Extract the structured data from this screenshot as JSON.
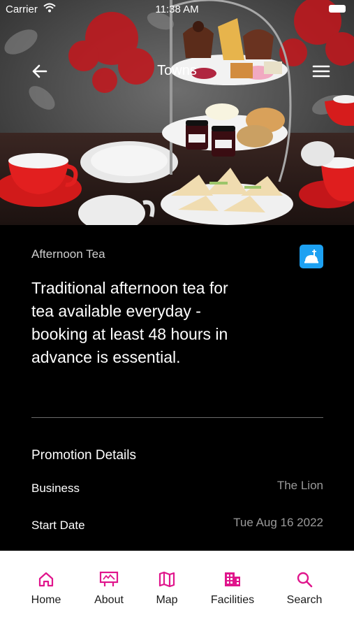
{
  "status_bar": {
    "carrier": "Carrier",
    "time": "11:38 AM"
  },
  "nav": {
    "title": "Towns"
  },
  "promotion": {
    "category": "Afternoon Tea",
    "description": "Traditional afternoon tea for tea available everyday - booking at least 48 hours in advance is essential."
  },
  "details": {
    "section_title": "Promotion Details",
    "rows": [
      {
        "label": "Business",
        "value": "The Lion"
      },
      {
        "label": "Start Date",
        "value": "Tue Aug 16 2022"
      }
    ]
  },
  "tabs": [
    {
      "label": "Home",
      "icon": "home-icon"
    },
    {
      "label": "About",
      "icon": "billboard-icon"
    },
    {
      "label": "Map",
      "icon": "map-icon"
    },
    {
      "label": "Facilities",
      "icon": "building-icon"
    },
    {
      "label": "Search",
      "icon": "search-icon"
    }
  ],
  "colors": {
    "accent": "#e0158c",
    "category_badge": "#1da1f2",
    "background": "#000000"
  }
}
